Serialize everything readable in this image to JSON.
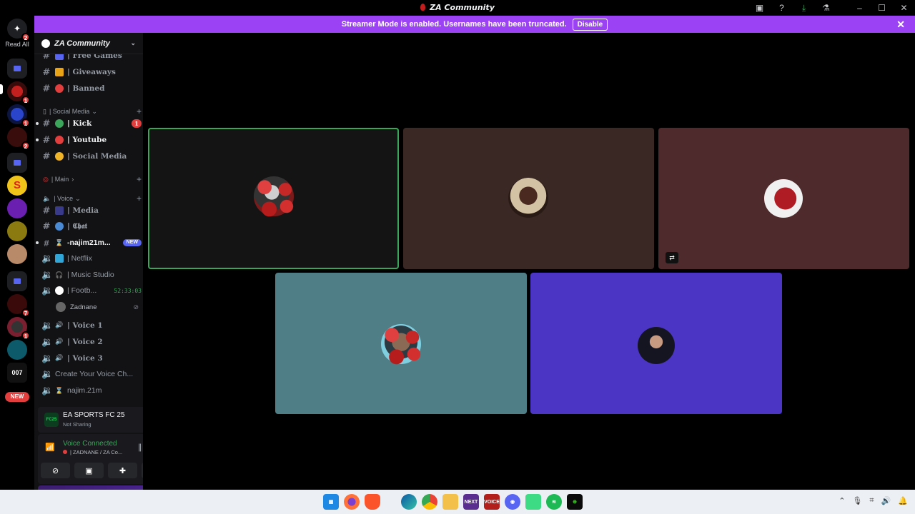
{
  "window": {
    "title": "ZA Community",
    "icons": [
      "inbox-icon",
      "help-icon",
      "download-icon",
      "mod-icon",
      "minimize-icon",
      "maximize-icon",
      "close-icon"
    ]
  },
  "banner": {
    "text": "Streamer Mode is enabled. Usernames have been truncated.",
    "disable_label": "Disable"
  },
  "server_rail": {
    "read_all": "Read All",
    "home_badge": "2",
    "new_label": "NEW",
    "badges": [
      "1",
      "1",
      "2",
      "7",
      "1"
    ]
  },
  "guild": {
    "name": "ZA Community"
  },
  "channels": {
    "free_games": "| Free  Games",
    "giveaways": "| Giveaways",
    "banned": "| Banned",
    "cat_social": "| Social Media",
    "kick": "| Kick",
    "kick_count": "1",
    "youtube": "| Youtube",
    "social_media": "| Social  Media",
    "cat_main": "| Main",
    "cat_voice": "| Voice",
    "media": "| Media",
    "chat": "| 𝕮𝖍𝖆𝖙",
    "najim": "-najim21m...",
    "new_tag": "NEW",
    "netflix": "| Netflix",
    "music_studio": "| Music Studio",
    "football": "| Footb...",
    "football_time": "52:33:03",
    "member_name": "Zadnane",
    "voice1": "| Voice 1",
    "voice2": "| Voice 2",
    "voice3": "| Voice 3",
    "create_voice": "Create Your Voice Ch...",
    "najim_voice": "najim.21m"
  },
  "activity": {
    "game_icon_text": "FC25",
    "game_title": "EA SPORTS FC 25",
    "game_status": "Not Sharing"
  },
  "voice": {
    "status": "Voice Connected",
    "location": "| ZADNANE / ZA Co..."
  },
  "tiles": [
    {
      "color": "#141414",
      "speaking": true
    },
    {
      "color": "#3a2825",
      "speaking": false
    },
    {
      "color": "#4e2a2c",
      "speaking": false
    },
    {
      "color": "#4f7e86",
      "speaking": false
    },
    {
      "color": "#4a35c4",
      "speaking": false
    }
  ],
  "taskbar": {
    "apps": [
      "windows-start",
      "firefox",
      "brave",
      "edge",
      "chrome",
      "file-explorer",
      "next-app",
      "voice-app",
      "discord",
      "android-app",
      "spotify",
      "razer"
    ],
    "next_label": "NEXT",
    "voice_label": "VOICE"
  }
}
